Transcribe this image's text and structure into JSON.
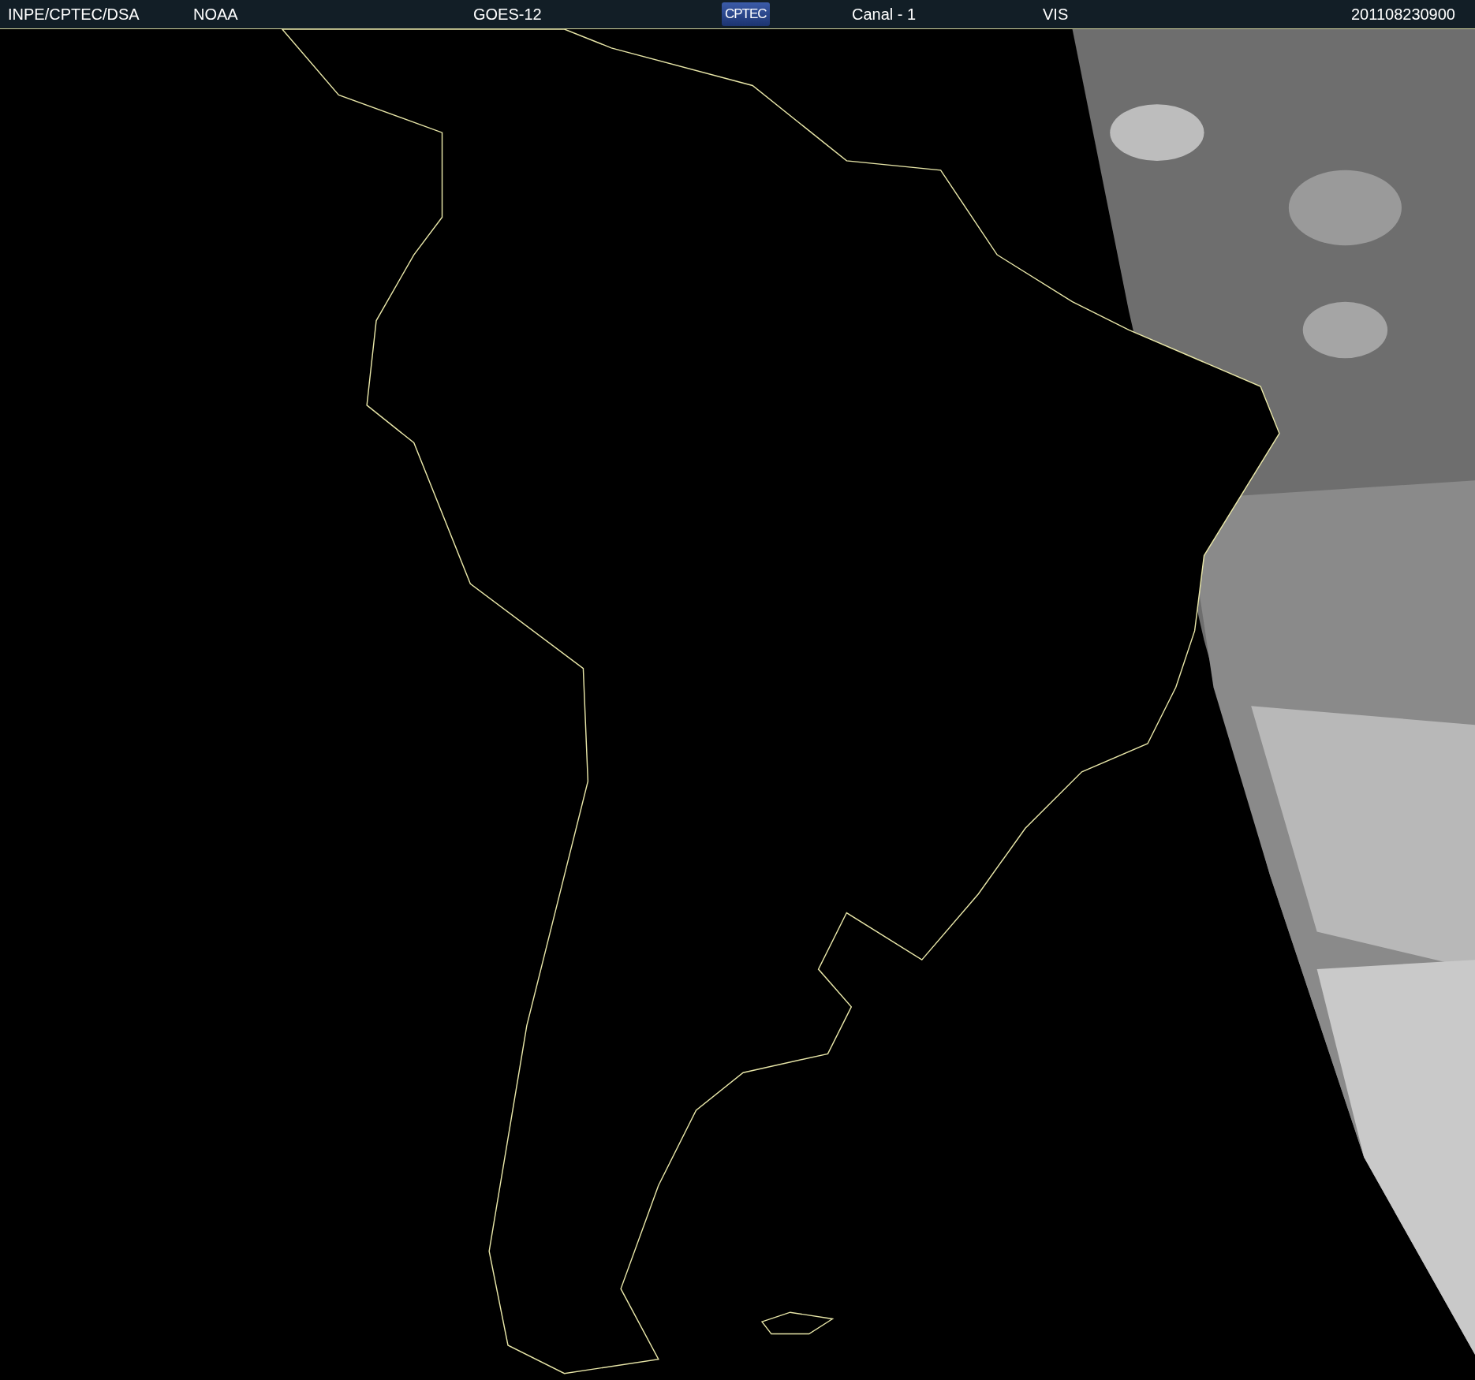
{
  "header": {
    "items": [
      {
        "kind": "text",
        "text": "INPE/CPTEC/DSA"
      },
      {
        "kind": "text",
        "text": "NOAA"
      },
      {
        "kind": "text",
        "text": "GOES-12"
      },
      {
        "kind": "logo",
        "text": "CPTEC"
      },
      {
        "kind": "text",
        "text": "Canal - 1"
      },
      {
        "kind": "text",
        "text": "VIS"
      },
      {
        "kind": "timestamp",
        "text": "201108230900"
      }
    ]
  }
}
